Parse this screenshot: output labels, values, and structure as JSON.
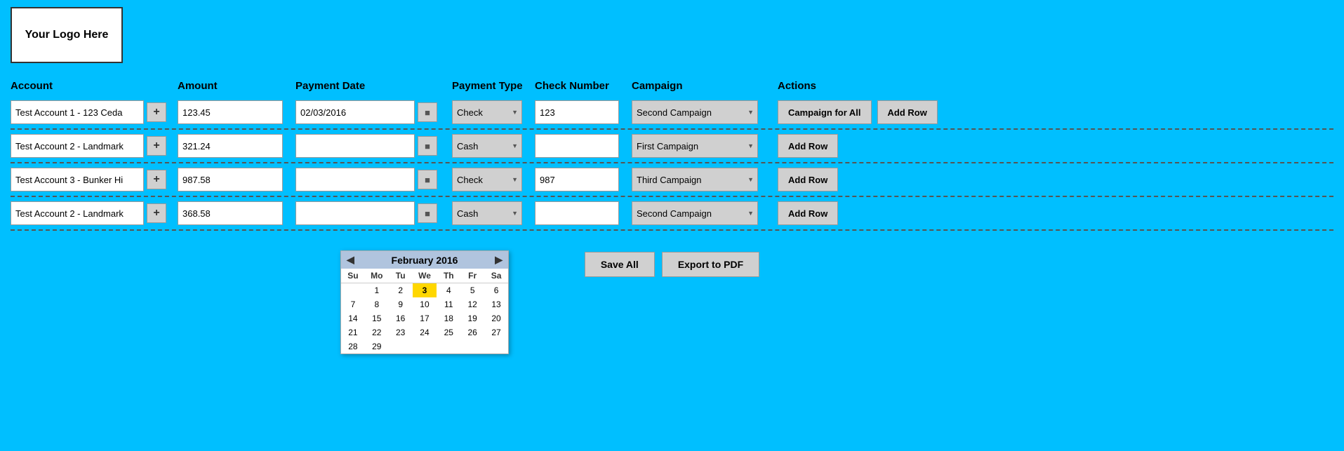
{
  "logo": {
    "text": "Your Logo Here"
  },
  "headers": {
    "account": "Account",
    "amount": "Amount",
    "payment_date": "Payment Date",
    "payment_type": "Payment Type",
    "check_number": "Check Number",
    "campaign": "Campaign",
    "actions": "Actions"
  },
  "rows": [
    {
      "id": 1,
      "account": "Test Account 1 - 123 Ceda",
      "amount": "123.45",
      "payment_date": "02/03/2016",
      "payment_type": "Check",
      "check_number": "123",
      "campaign": "Second Campaign",
      "show_calendar": true
    },
    {
      "id": 2,
      "account": "Test Account 2 - Landmark",
      "amount": "321.24",
      "payment_date": "",
      "payment_type": "Cash",
      "check_number": "",
      "campaign": "First Campaign",
      "show_calendar": false
    },
    {
      "id": 3,
      "account": "Test Account 3 - Bunker Hi",
      "amount": "987.58",
      "payment_date": "",
      "payment_type": "Check",
      "check_number": "987",
      "campaign": "Third Campaign",
      "show_calendar": false
    },
    {
      "id": 4,
      "account": "Test Account 2 - Landmark",
      "amount": "368.58",
      "payment_date": "",
      "payment_type": "Cash",
      "check_number": "",
      "campaign": "Second Campaign",
      "show_calendar": false
    }
  ],
  "calendar": {
    "title": "February 2016",
    "days_header": [
      "Su",
      "Mo",
      "Tu",
      "We",
      "Th",
      "Fr",
      "Sa"
    ],
    "weeks": [
      [
        "",
        "",
        "1",
        "2",
        "3",
        "4",
        "5",
        "6"
      ],
      [
        "7",
        "8",
        "9",
        "10",
        "11",
        "12",
        "13"
      ],
      [
        "14",
        "15",
        "16",
        "17",
        "18",
        "19",
        "20"
      ],
      [
        "21",
        "22",
        "23",
        "24",
        "25",
        "26",
        "27"
      ],
      [
        "28",
        "29",
        "",
        "",
        "",
        "",
        ""
      ]
    ],
    "today": "3"
  },
  "campaigns": [
    "Second Campaign",
    "First Campaign",
    "Third Campaign",
    "Campaign for All"
  ],
  "payment_types": [
    "Check",
    "Cash"
  ],
  "buttons": {
    "campaign_for_all": "Campaign for All",
    "add_row": "Add Row",
    "save_all": "Save All",
    "export_pdf": "Export to PDF"
  }
}
